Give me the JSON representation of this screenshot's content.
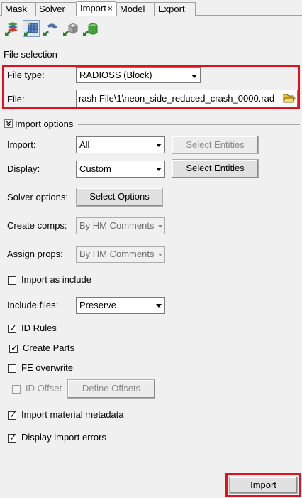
{
  "tabs": [
    {
      "label": "Mask"
    },
    {
      "label": "Solver"
    },
    {
      "label": "Import",
      "close": "×"
    },
    {
      "label": "Model"
    },
    {
      "label": "Export"
    }
  ],
  "toolbar": {
    "icons": [
      "import-model-icon",
      "import-geometry-icon",
      "import-solver-deck-icon",
      "import-fe-overlay-icon",
      "import-connectors-icon"
    ]
  },
  "file_selection": {
    "header": "File selection",
    "file_type_label": "File type:",
    "file_type_value": "RADIOSS (Block)",
    "file_label": "File:",
    "file_value": "rash File\\1\\neon_side_reduced_crash_0000.rad"
  },
  "import_options": {
    "header": "Import options",
    "import_label": "Import:",
    "import_value": "All",
    "select_entities_disabled": "Select Entities",
    "display_label": "Display:",
    "display_value": "Custom",
    "select_entities": "Select Entities",
    "solver_options_label": "Solver options:",
    "select_options": "Select Options",
    "create_comps_label": "Create comps:",
    "create_comps_value": "By HM Comments",
    "assign_props_label": "Assign props:",
    "assign_props_value": "By HM Comments",
    "import_as_include": "Import as include",
    "include_files_label": "Include files:",
    "include_files_value": "Preserve",
    "id_rules": "ID Rules",
    "create_parts": "Create Parts",
    "fe_overwrite": "FE overwrite",
    "id_offset": "ID Offset",
    "define_offsets": "Define Offsets",
    "import_material_metadata": "Import material metadata",
    "display_import_errors": "Display import errors"
  },
  "checkboxes": {
    "import_as_include": false,
    "id_rules": true,
    "create_parts": true,
    "fe_overwrite": false,
    "id_offset": false,
    "import_material_metadata": true,
    "display_import_errors": true
  },
  "footer": {
    "import_button": "Import"
  },
  "colors": {
    "highlight": "#e01020",
    "background": "#f0f0f0"
  }
}
